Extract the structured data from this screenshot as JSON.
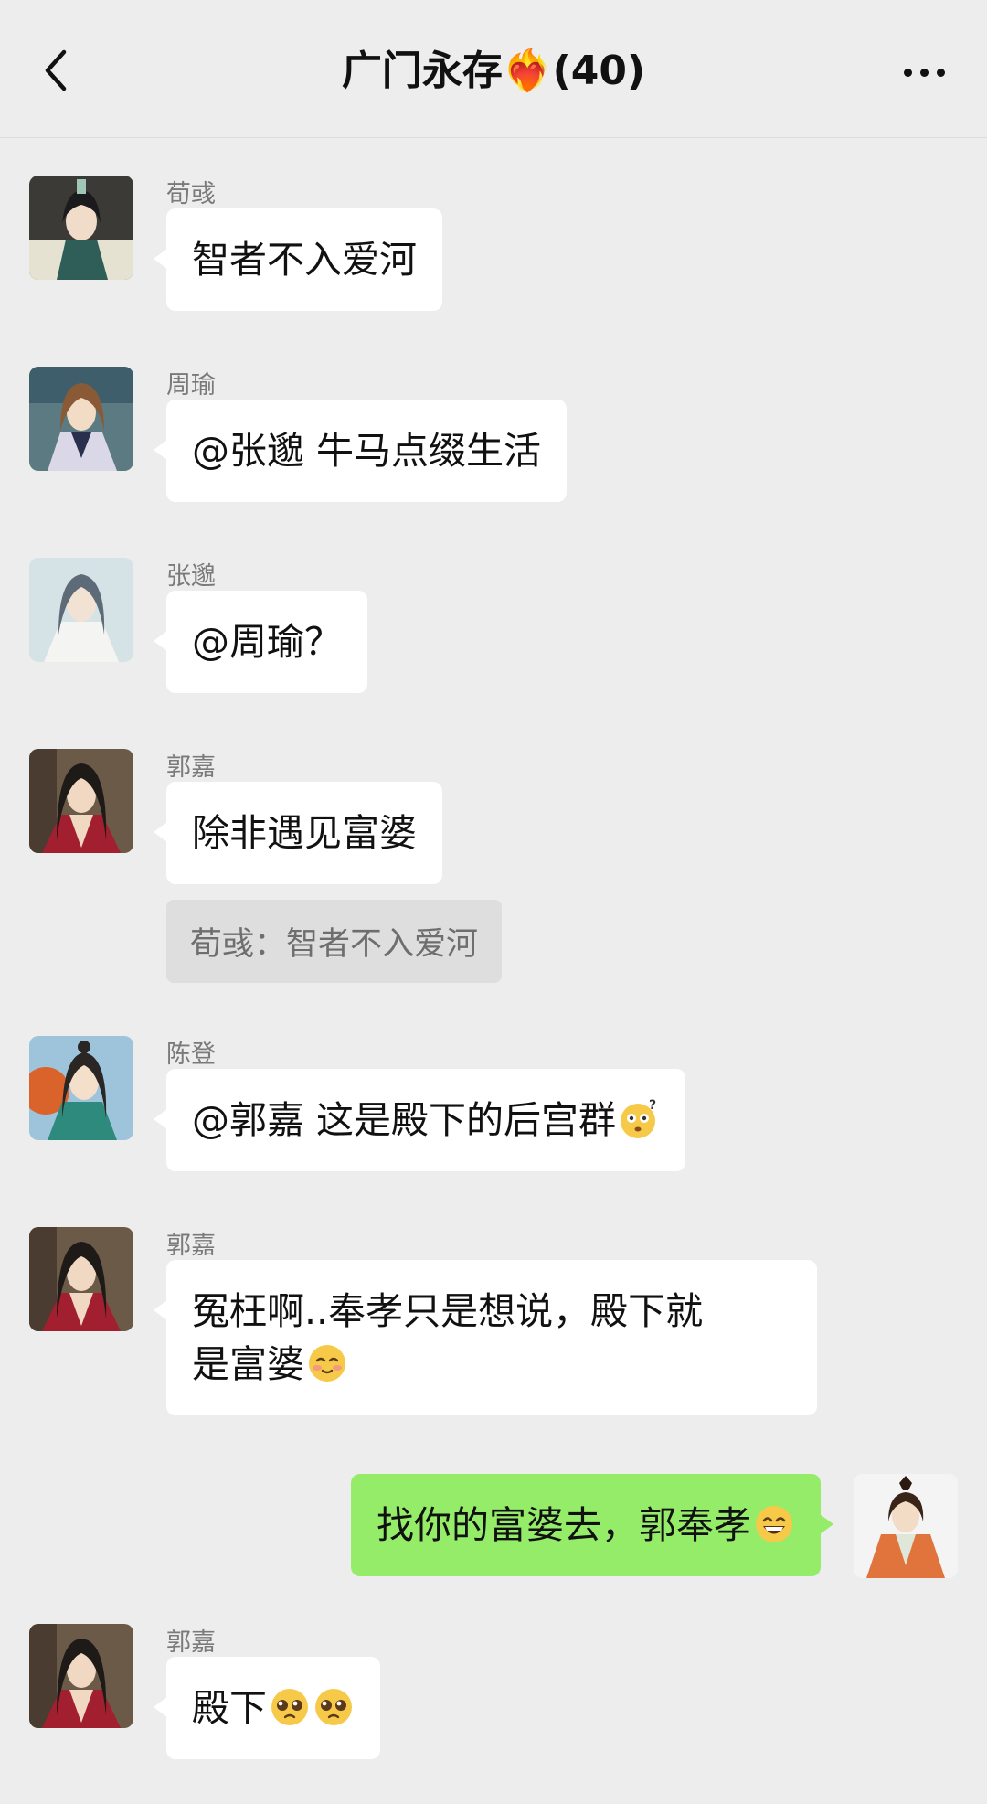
{
  "header": {
    "title": "广门永存❤️‍🔥(40)"
  },
  "messages": [
    {
      "sender": "荀彧",
      "text": "智者不入爱河"
    },
    {
      "sender": "周瑜",
      "text": "@张邈 牛马点缀生活"
    },
    {
      "sender": "张邈",
      "text": "@周瑜？"
    },
    {
      "sender": "郭嘉",
      "text": "除非遇见富婆",
      "quote": "荀彧：智者不入爱河"
    },
    {
      "sender": "陈登",
      "text": "@郭嘉 这是殿下的后宫群",
      "emoji": "flushed-question-emoji"
    },
    {
      "sender": "郭嘉",
      "text_line1": "冤枉啊..奉孝只是想说，殿下就",
      "text_line2": "是富婆",
      "emoji": "blushing-smile-emoji"
    },
    {
      "sender": "me",
      "text": "找你的富婆去，郭奉孝",
      "emoji": "grinning-emoji"
    },
    {
      "sender": "郭嘉",
      "text": "殿下",
      "emoji": "pleading-emoji"
    }
  ],
  "colors": {
    "background": "#ededed",
    "bubble_other": "#ffffff",
    "bubble_self": "#95ec69",
    "quote_bg": "#dedede"
  }
}
